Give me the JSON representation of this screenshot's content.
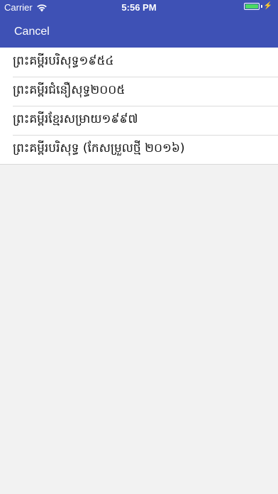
{
  "status_bar": {
    "carrier": "Carrier",
    "time": "5:56 PM",
    "battery_level": 1.0,
    "battery_color": "#4cd964"
  },
  "navbar": {
    "cancel_label": "Cancel",
    "background_color": "#3e51b5"
  },
  "list": {
    "items": [
      {
        "label": "ព្រះគម្ពីរបរិសុទ្ធ១៩៥៤"
      },
      {
        "label": "ព្រះគម្ពីរជំនឿសុទ្ធ២០០៥"
      },
      {
        "label": "ព្រះគម្ពីរខ្មែរសម្រាយ១៩៩៧"
      },
      {
        "label": "ព្រះគម្ពីរបរិសុទ្ធ (កែសម្រួលថ្មី ២០១៦)"
      }
    ]
  }
}
